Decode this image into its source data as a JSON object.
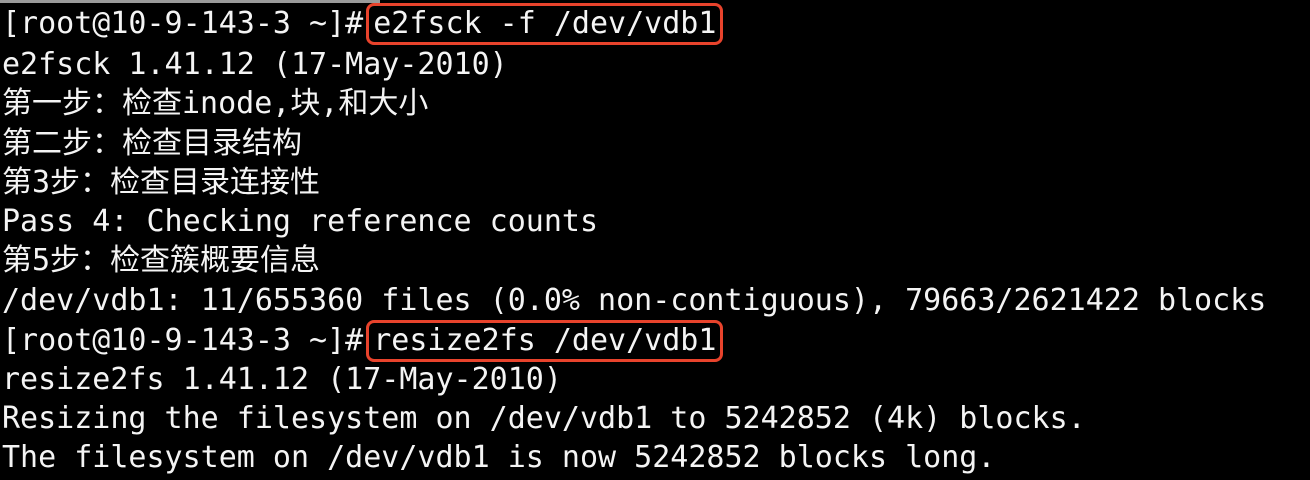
{
  "terminal": {
    "colors": {
      "background": "#000000",
      "text": "#f4f4f4",
      "highlight_box": "#e8432c"
    },
    "commands": [
      {
        "prompt": "[root@10-9-143-3 ~]#",
        "command": "e2fsck -f /dev/vdb1"
      },
      {
        "prompt": "[root@10-9-143-3 ~]#",
        "command": "resize2fs /dev/vdb1"
      }
    ],
    "lines": [
      "e2fsck 1.41.12 (17-May-2010)",
      "第一步：检查inode,块,和大小",
      "第二步：检查目录结构",
      "第3步：检查目录连接性",
      "Pass 4: Checking reference counts",
      "第5步：检查簇概要信息",
      "/dev/vdb1: 11/655360 files (0.0% non-contiguous), 79663/2621422 blocks",
      "resize2fs 1.41.12 (17-May-2010)",
      "Resizing the filesystem on /dev/vdb1 to 5242852 (4k) blocks.",
      "The filesystem on /dev/vdb1 is now 5242852 blocks long."
    ]
  }
}
